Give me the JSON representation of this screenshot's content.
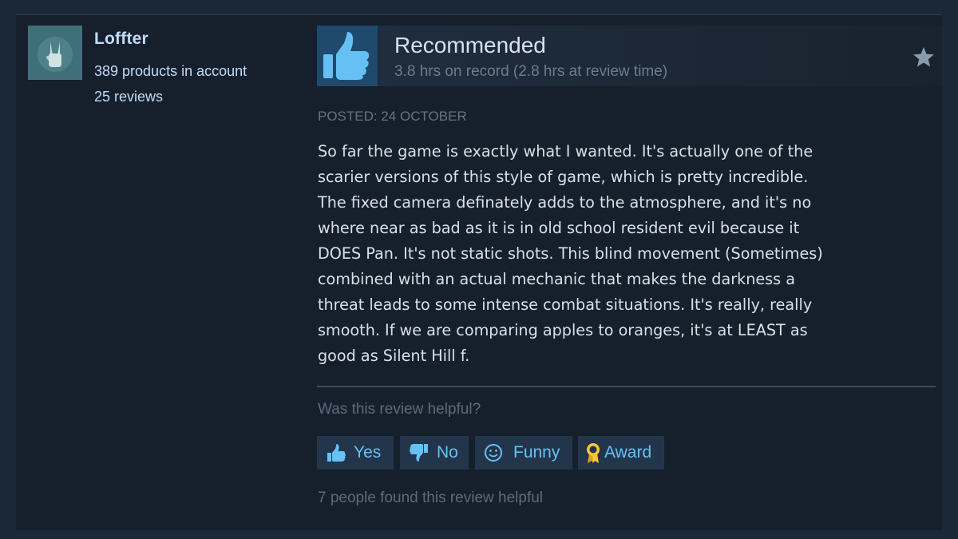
{
  "author": {
    "name": "Loffter",
    "products": "389 products in account",
    "reviews": "25 reviews",
    "avatar_icon": "peace-hand-avatar-icon"
  },
  "review": {
    "verdict": "Recommended",
    "verdict_icon": "thumbs-up-icon",
    "hours": "3.8 hrs on record (2.8 hrs at review time)",
    "posted": "Posted: 24 October",
    "text_lines": [
      "So far the game is exactly what I wanted. It's actually one of the",
      "scarier versions of this style of game, which is pretty incredible.",
      "The fixed camera definately adds to the atmosphere, and it's no",
      "where near as bad as it is in old school resident evil because it",
      "DOES Pan. It's not static shots. This blind movement (Sometimes)",
      "combined with an actual mechanic that makes the darkness a",
      "threat leads to some intense combat situations. It's really, really",
      "smooth. If we are comparing apples to oranges, it's at LEAST as",
      "good as Silent Hill f."
    ]
  },
  "helpful": {
    "question": "Was this review helpful?",
    "buttons": {
      "yes": "Yes",
      "no": "No",
      "funny": "Funny",
      "award": "Award"
    },
    "found": "7 people found this review helpful"
  },
  "colors": {
    "page_bg": "#1b2838",
    "card_bg": "#16202d",
    "accent": "#67c1f5",
    "award_gold": "#ffc82c"
  }
}
